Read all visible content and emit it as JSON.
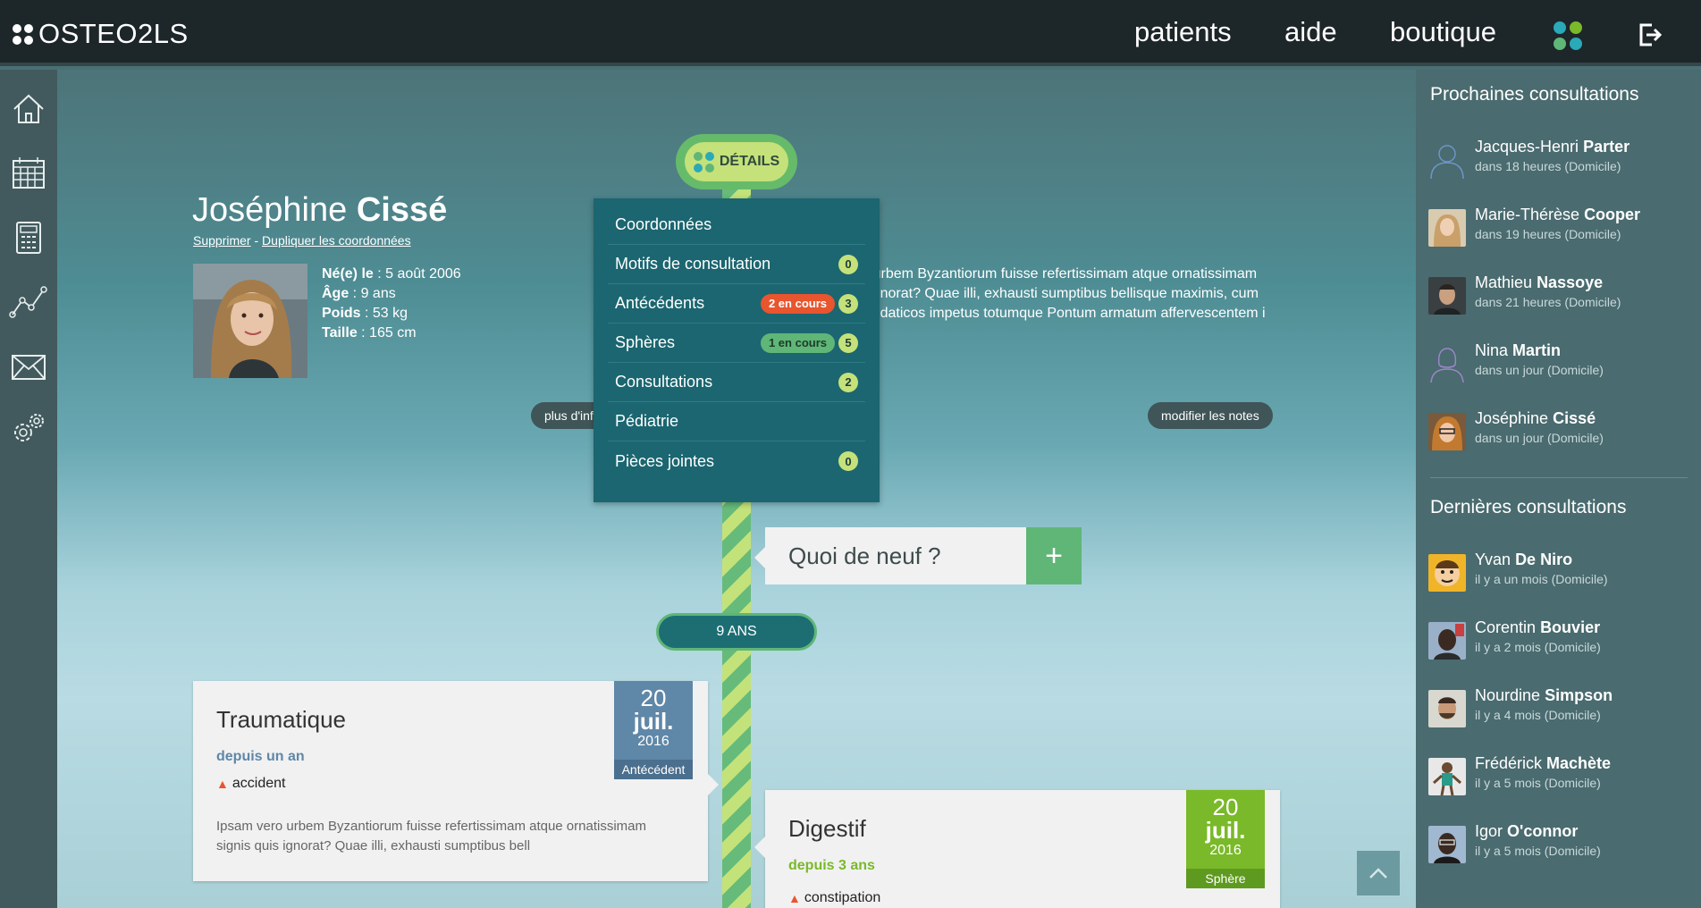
{
  "app": {
    "logo_text": "OSTEO2LS"
  },
  "nav": {
    "patients": "patients",
    "aide": "aide",
    "boutique": "boutique"
  },
  "colors": {
    "accent_green": "#5fb677",
    "accent_lime": "#c5e17a",
    "teal_dark": "#1b6670",
    "orange": "#e8552e",
    "blue_date": "#5f87a8",
    "green_date": "#7ab929"
  },
  "patient": {
    "first_name": "Joséphine",
    "last_name": "Cissé",
    "delete_link": "Supprimer",
    "separator": " - ",
    "duplicate_link": "Dupliquer les coordonnées",
    "born_label": "Né(e) le",
    "born_value": " : 5 août 2006",
    "age_label": "Âge",
    "age_value": " : 9 ans",
    "weight_label": "Poids",
    "weight_value": " : 53 kg",
    "height_label": "Taille",
    "height_value": " : 165 cm",
    "notes_line1": "Ipsam vero urbem Byzantiorum fuisse refertissimam atque ornatissimam",
    "notes_line2": "signis quis ignorat? Quae illi, exhausti sumptibus bellisque maximis, cum",
    "notes_line3": "omnes Mithridaticos impetus totumque Pontum armatum affervescentem i",
    "more_info_btn": "plus d'informations",
    "edit_notes_btn": "modifier les notes"
  },
  "details": {
    "button_label": "DÉTAILS",
    "menu": [
      {
        "label": "Coordonnées"
      },
      {
        "label": "Motifs de consultation",
        "count": "0"
      },
      {
        "label": "Antécédents",
        "tag": "2 en cours",
        "count": "3"
      },
      {
        "label": "Sphères",
        "tag": "1 en cours",
        "count": "5"
      },
      {
        "label": "Consultations",
        "count": "2"
      },
      {
        "label": "Pédiatrie"
      },
      {
        "label": "Pièces jointes",
        "count": "0"
      }
    ]
  },
  "timeline": {
    "quoi_de_neuf": "Quoi de neuf ?",
    "add_symbol": "+",
    "age_marker": "9 ANS",
    "cards": [
      {
        "title": "Traumatique",
        "since": "depuis un an",
        "tag": "accident",
        "text_line1": "Ipsam vero urbem Byzantiorum fuisse refertissimam atque ornatissimam",
        "text_line2": "signis quis ignorat? Quae illi, exhausti sumptibus bell",
        "day": "20",
        "month": "juil.",
        "year": "2016",
        "type": "Antécédent"
      },
      {
        "title": "Digestif",
        "since": "depuis 3 ans",
        "tag": "constipation",
        "day": "20",
        "month": "juil.",
        "year": "2016",
        "type": "Sphère"
      }
    ]
  },
  "sidebar_right": {
    "upcoming_title": "Prochaines consultations",
    "upcoming": [
      {
        "first": "Jacques-Henri",
        "last": "Parter",
        "when": "dans 18 heures (Domicile)"
      },
      {
        "first": "Marie-Thérèse",
        "last": "Cooper",
        "when": "dans 19 heures (Domicile)"
      },
      {
        "first": "Mathieu",
        "last": "Nassoye",
        "when": "dans 21 heures (Domicile)"
      },
      {
        "first": "Nina",
        "last": "Martin",
        "when": "dans un jour (Domicile)"
      },
      {
        "first": "Joséphine",
        "last": "Cissé",
        "when": "dans un jour (Domicile)"
      }
    ],
    "recent_title": "Dernières consultations",
    "recent": [
      {
        "first": "Yvan",
        "last": "De Niro",
        "when": "il y a un mois (Domicile)"
      },
      {
        "first": "Corentin",
        "last": "Bouvier",
        "when": "il y a 2 mois (Domicile)"
      },
      {
        "first": "Nourdine",
        "last": "Simpson",
        "when": "il y a 4 mois (Domicile)"
      },
      {
        "first": "Frédérick",
        "last": "Machète",
        "when": "il y a 5 mois (Domicile)"
      },
      {
        "first": "Igor",
        "last": "O'connor",
        "when": "il y a 5 mois (Domicile)"
      }
    ]
  }
}
